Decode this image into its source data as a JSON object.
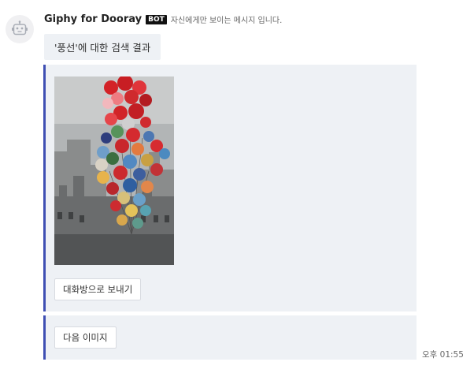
{
  "message": {
    "sender": "Giphy for Dooray",
    "badge": "BOT",
    "visibility_note": "자신에게만 보이는 메시지 입니다.",
    "query_text": "'풍선'에 대한 검색 결과",
    "timestamp": "오후 01:55"
  },
  "result_card": {
    "send_button_label": "대화방으로 보내기"
  },
  "next_card": {
    "next_button_label": "다음 이미지"
  },
  "icons": {
    "avatar": "robot-icon"
  },
  "colors": {
    "accent": "#3f4fb3",
    "card_background": "#eef1f5",
    "badge_background": "#111111"
  }
}
